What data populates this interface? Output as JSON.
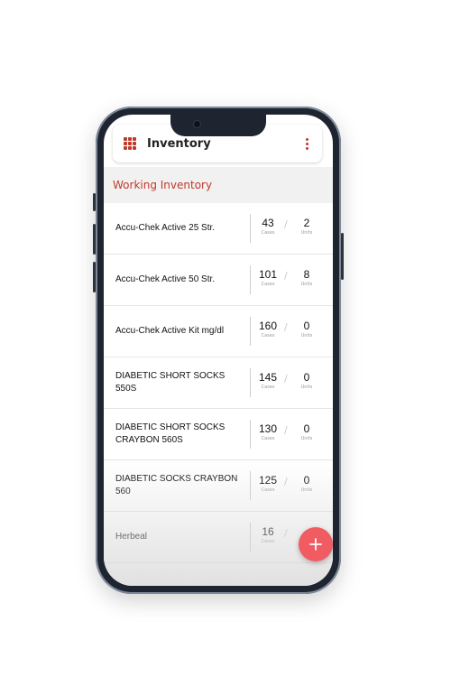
{
  "app": {
    "title": "Inventory",
    "accent_color": "#c0392b",
    "fab_color": "#f15b62"
  },
  "icons": {
    "menu": "grid-menu-icon",
    "more": "kebab-menu-icon",
    "fab": "plus-icon"
  },
  "section": {
    "title": "Working Inventory"
  },
  "items": [
    {
      "name": "Accu-Chek Active 25 Str.",
      "cases": "43",
      "units": "2",
      "cases_label": "Cases",
      "units_label": "Units"
    },
    {
      "name": "Accu-Chek Active 50 Str.",
      "cases": "101",
      "units": "8",
      "cases_label": "Cases",
      "units_label": "Units"
    },
    {
      "name": "Accu-Chek Active Kit mg/dl",
      "cases": "160",
      "units": "0",
      "cases_label": "Cases",
      "units_label": "Units"
    },
    {
      "name": "DIABETIC SHORT SOCKS 550S",
      "cases": "145",
      "units": "0",
      "cases_label": "Cases",
      "units_label": "Units"
    },
    {
      "name": "DIABETIC SHORT SOCKS CRAYBON 560S",
      "cases": "130",
      "units": "0",
      "cases_label": "Cases",
      "units_label": "Units"
    },
    {
      "name": "DIABETIC SOCKS CRAYBON 560",
      "cases": "125",
      "units": "0",
      "cases_label": "Cases",
      "units_label": "Units"
    },
    {
      "name": "Herbeal",
      "cases": "16",
      "units": "",
      "cases_label": "Cases",
      "units_label": ""
    }
  ]
}
